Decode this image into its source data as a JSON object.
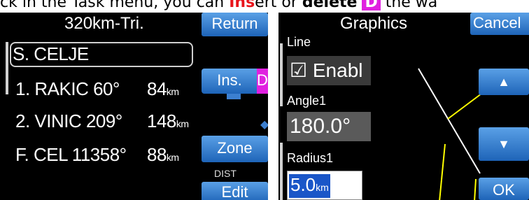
{
  "caption": {
    "prefix": "ck in the Task menu, you can ",
    "ins": "Ins",
    "mid": "ert or ",
    "delete": "delete",
    "dkey": "D",
    "suffix": " the wa"
  },
  "left": {
    "title": "320km-Tri.",
    "return_label": "Return",
    "ins_label": "Ins.",
    "d_label": "D",
    "zone_label": "Zone",
    "dist_label": "DIST",
    "edit_label": "Edit",
    "rows": [
      {
        "name": "S. CELJE",
        "angle": "",
        "dist": "",
        "unit": ""
      },
      {
        "name": "1. RAKIC 60°",
        "angle": "",
        "dist": "84",
        "unit": "km"
      },
      {
        "name": "2. VINIC  209°",
        "angle": "",
        "dist": "148",
        "unit": "km"
      },
      {
        "name": "F. CEL 11358°",
        "angle": "",
        "dist": "88",
        "unit": "km"
      }
    ]
  },
  "right": {
    "title": "Graphics",
    "cancel_label": "Cancel",
    "line_label": "Line",
    "enable_label": "☑ Enabl",
    "angle_label": "Angle1",
    "angle_value": "180.0°",
    "radius_label": "Radius1",
    "radius_value": "5.0",
    "radius_unit": "km",
    "ok_label": "OK",
    "up_icon": "▲",
    "down_icon": "▼"
  },
  "colors": {
    "button_top": "#5aa0e6",
    "button_bottom": "#1e64b8",
    "delete_key": "#e020e0",
    "insert_text": "#e8141b",
    "radius_highlight": "#1a56c8",
    "sector_line": "#ffff00"
  }
}
